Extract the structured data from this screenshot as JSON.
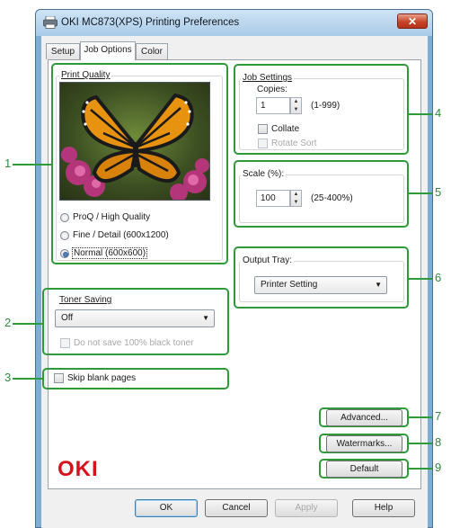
{
  "window": {
    "title": "OKI MC873(XPS) Printing Preferences",
    "close_glyph": "✕"
  },
  "tabs": [
    {
      "label": "Setup"
    },
    {
      "label": "Job Options"
    },
    {
      "label": "Color"
    }
  ],
  "print_quality": {
    "legend": "Print Quality",
    "options": [
      {
        "label": "ProQ / High Quality",
        "selected": false
      },
      {
        "label": "Fine / Detail (600x1200)",
        "selected": false
      },
      {
        "label": "Normal (600x600)",
        "selected": true
      }
    ]
  },
  "job_settings": {
    "legend": "Job Settings",
    "copies_label": "Copies:",
    "copies_value": "1",
    "copies_range": "(1-999)",
    "collate_label": "Collate",
    "collate_checked": false,
    "rotate_sort_label": "Rotate Sort",
    "rotate_sort_checked": false
  },
  "scale": {
    "label": "Scale (%):",
    "value": "100",
    "range": "(25-400%)"
  },
  "output_tray": {
    "label": "Output Tray:",
    "value": "Printer Setting"
  },
  "toner_saving": {
    "label": "Toner Saving",
    "value": "Off",
    "no_black_label": "Do not save 100% black toner",
    "no_black_checked": false
  },
  "skip_blank": {
    "label": "Skip blank pages",
    "checked": false
  },
  "side_buttons": {
    "advanced": "Advanced...",
    "watermarks": "Watermarks...",
    "default": "Default"
  },
  "footer_buttons": {
    "ok": "OK",
    "cancel": "Cancel",
    "apply": "Apply",
    "help": "Help"
  },
  "logo_text": "OKI",
  "callouts": [
    "1",
    "2",
    "3",
    "4",
    "5",
    "6",
    "7",
    "8",
    "9"
  ],
  "colors": {
    "callout_green": "#2e9b3a",
    "logo_red": "#d6121a",
    "title_bar": "#a9cbe8"
  },
  "icons": {
    "printer": "printer-icon",
    "spin_up": "▲",
    "spin_down": "▼",
    "dropdown": "▼"
  }
}
